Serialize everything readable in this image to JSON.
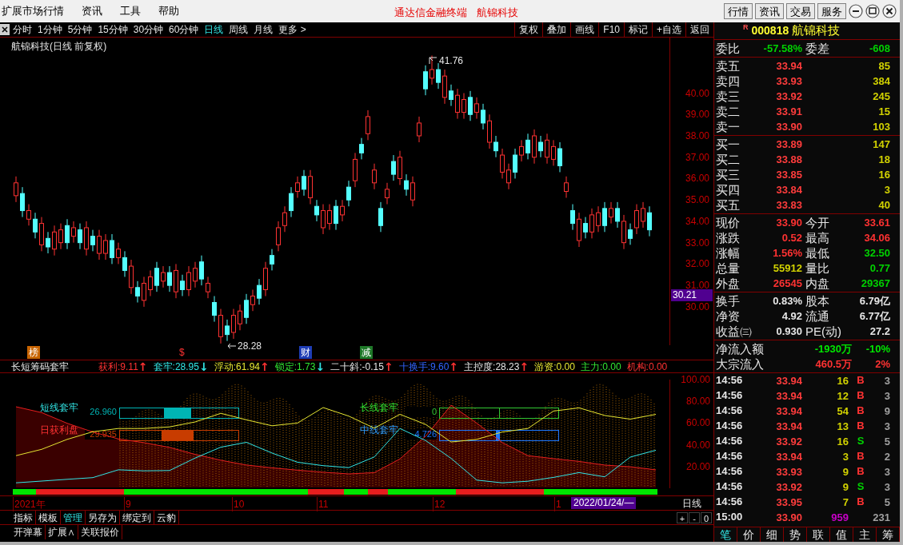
{
  "menu": [
    "扩展市场行情",
    "资讯",
    "工具",
    "帮助"
  ],
  "window": {
    "title": "通达信金融终端",
    "stock": "航锦科技"
  },
  "top_buttons": [
    "行情",
    "资讯",
    "交易",
    "服务"
  ],
  "period_tabs": [
    {
      "label": "分时",
      "selected": false
    },
    {
      "label": "1分钟",
      "selected": false
    },
    {
      "label": "5分钟",
      "selected": false
    },
    {
      "label": "15分钟",
      "selected": false
    },
    {
      "label": "30分钟",
      "selected": false
    },
    {
      "label": "60分钟",
      "selected": false
    },
    {
      "label": "日线",
      "selected": true
    },
    {
      "label": "周线",
      "selected": false
    },
    {
      "label": "月线",
      "selected": false
    },
    {
      "label": "更多 >",
      "selected": false
    }
  ],
  "tools": [
    "复权",
    "叠加",
    "画线",
    "F10",
    "标记",
    "+自选",
    "返回"
  ],
  "chart": {
    "title": "航锦科技(日线 前复权)",
    "high_label": "41.76",
    "low_label": "28.28",
    "current_price": "30.21",
    "chart_data": {
      "type": "candlestick",
      "ylim": [
        28.2,
        42.6
      ],
      "yticks": [
        {
          "value": 40,
          "label": "40.00"
        },
        {
          "value": 39,
          "label": "39.00"
        },
        {
          "value": 38,
          "label": "38.00"
        },
        {
          "value": 37,
          "label": "37.00"
        },
        {
          "value": 36,
          "label": "36.00"
        },
        {
          "value": 35,
          "label": "35.00"
        },
        {
          "value": 34,
          "label": "34.00"
        },
        {
          "value": 33,
          "label": "33.00"
        },
        {
          "value": 32,
          "label": "32.00"
        },
        {
          "value": 31,
          "label": "31.00"
        },
        {
          "value": 30,
          "label": "30.00"
        }
      ],
      "ohlc": [
        [
          35.2,
          36.1,
          34.9,
          35.8
        ],
        [
          35.3,
          35.6,
          34.2,
          34.5
        ],
        [
          34.1,
          34.8,
          33.8,
          34.5
        ],
        [
          34.1,
          34.4,
          33.2,
          33.5
        ],
        [
          32.9,
          34.2,
          32.6,
          33.9
        ],
        [
          33.2,
          33.5,
          32.5,
          32.8
        ],
        [
          32.7,
          33.8,
          32.4,
          33.5
        ],
        [
          33.0,
          33.9,
          32.7,
          33.6
        ],
        [
          33.8,
          34.1,
          32.7,
          33.0
        ],
        [
          33.3,
          34.0,
          33.0,
          33.7
        ],
        [
          33.6,
          33.9,
          32.7,
          33.0
        ],
        [
          32.7,
          34.0,
          32.4,
          33.7
        ],
        [
          33.3,
          33.6,
          32.6,
          32.9
        ],
        [
          32.5,
          33.6,
          32.2,
          33.3
        ],
        [
          32.5,
          33.4,
          32.2,
          33.1
        ],
        [
          33.1,
          33.4,
          32.0,
          32.3
        ],
        [
          32.3,
          33.0,
          32.0,
          32.7
        ],
        [
          32.3,
          32.6,
          31.4,
          31.7
        ],
        [
          30.9,
          32.2,
          30.6,
          31.9
        ],
        [
          30.9,
          31.2,
          30.2,
          30.5
        ],
        [
          30.3,
          31.4,
          30.0,
          31.1
        ],
        [
          30.8,
          31.7,
          30.5,
          31.4
        ],
        [
          31.8,
          32.1,
          30.7,
          31.0
        ],
        [
          31.2,
          31.9,
          30.9,
          31.6
        ],
        [
          31.6,
          31.9,
          30.7,
          31.0
        ],
        [
          30.7,
          32.0,
          30.4,
          31.7
        ],
        [
          31.2,
          31.5,
          30.5,
          30.8
        ],
        [
          30.8,
          31.9,
          30.5,
          31.6
        ],
        [
          31.2,
          32.1,
          30.9,
          31.8
        ],
        [
          32.1,
          32.4,
          31.0,
          31.3
        ],
        [
          30.7,
          31.4,
          30.4,
          31.1
        ],
        [
          30.2,
          30.5,
          29.3,
          29.6
        ],
        [
          28.6,
          29.9,
          28.28,
          29.6
        ],
        [
          29.1,
          29.4,
          28.4,
          28.7
        ],
        [
          28.8,
          29.9,
          28.5,
          29.6
        ],
        [
          29.2,
          30.1,
          28.9,
          29.8
        ],
        [
          30.3,
          30.6,
          29.2,
          29.5
        ],
        [
          30.1,
          30.8,
          29.8,
          30.5
        ],
        [
          31.0,
          31.3,
          30.1,
          30.4
        ],
        [
          30.8,
          32.1,
          30.5,
          31.8
        ],
        [
          32.4,
          32.7,
          31.7,
          32.0
        ],
        [
          32.9,
          34.0,
          32.6,
          33.7
        ],
        [
          33.8,
          34.7,
          33.5,
          34.4
        ],
        [
          35.3,
          35.6,
          34.2,
          34.5
        ],
        [
          35.4,
          36.1,
          35.1,
          35.8
        ],
        [
          36.1,
          36.4,
          35.2,
          35.5
        ],
        [
          35.1,
          36.4,
          34.8,
          36.1
        ],
        [
          34.7,
          35.0,
          34.0,
          34.3
        ],
        [
          33.7,
          34.8,
          33.4,
          34.5
        ],
        [
          33.9,
          34.8,
          33.6,
          34.5
        ],
        [
          34.7,
          35.0,
          33.6,
          33.9
        ],
        [
          34.3,
          35.0,
          34.0,
          34.7
        ],
        [
          35.6,
          35.9,
          34.7,
          35.0
        ],
        [
          35.9,
          37.2,
          35.6,
          36.9
        ],
        [
          37.6,
          37.9,
          36.9,
          37.2
        ],
        [
          38.1,
          39.2,
          37.8,
          38.9
        ],
        [
          35.8,
          36.7,
          35.5,
          36.4
        ],
        [
          34.6,
          34.9,
          33.5,
          33.8
        ],
        [
          35.1,
          35.8,
          34.8,
          35.5
        ],
        [
          36.8,
          37.1,
          35.9,
          36.2
        ],
        [
          36.0,
          37.3,
          35.7,
          37.0
        ],
        [
          35.9,
          36.2,
          35.2,
          35.5
        ],
        [
          35.0,
          36.1,
          34.7,
          35.8
        ],
        [
          38.0,
          38.9,
          37.7,
          38.6
        ],
        [
          41.0,
          41.3,
          39.9,
          40.2
        ],
        [
          40.7,
          41.76,
          40.4,
          41.1
        ],
        [
          41.1,
          41.4,
          40.2,
          40.5
        ],
        [
          39.8,
          41.1,
          39.5,
          40.8
        ],
        [
          40.1,
          40.4,
          39.4,
          39.7
        ],
        [
          39.1,
          40.2,
          38.8,
          39.9
        ],
        [
          39.1,
          40.0,
          38.8,
          39.7
        ],
        [
          39.8,
          40.1,
          38.7,
          39.0
        ],
        [
          39.1,
          39.8,
          38.8,
          39.5
        ],
        [
          39.2,
          39.5,
          38.3,
          38.6
        ],
        [
          37.7,
          39.0,
          37.4,
          38.7
        ],
        [
          37.7,
          38.0,
          37.0,
          37.3
        ],
        [
          36.3,
          37.4,
          36.0,
          37.1
        ],
        [
          35.8,
          36.7,
          35.5,
          36.4
        ],
        [
          37.1,
          37.4,
          36.0,
          36.3
        ],
        [
          37.1,
          37.8,
          36.8,
          37.5
        ],
        [
          37.8,
          38.1,
          36.9,
          37.2
        ],
        [
          37.0,
          38.3,
          36.7,
          38.0
        ],
        [
          37.7,
          38.0,
          37.0,
          37.3
        ],
        [
          37.0,
          38.1,
          36.7,
          37.8
        ],
        [
          36.9,
          37.8,
          36.6,
          37.5
        ],
        [
          37.4,
          37.7,
          36.3,
          36.6
        ],
        [
          35.4,
          36.1,
          35.1,
          35.8
        ],
        [
          34.5,
          34.8,
          33.6,
          33.9
        ],
        [
          33.1,
          34.4,
          32.8,
          34.1
        ],
        [
          33.9,
          34.2,
          33.2,
          33.5
        ],
        [
          33.5,
          34.6,
          33.2,
          34.3
        ],
        [
          33.8,
          34.7,
          33.5,
          34.4
        ],
        [
          34.6,
          34.9,
          33.5,
          33.8
        ],
        [
          34.2,
          34.9,
          33.9,
          34.6
        ],
        [
          34.6,
          34.9,
          33.7,
          34.0
        ],
        [
          33.0,
          34.3,
          32.7,
          34.0
        ],
        [
          33.6,
          33.9,
          32.9,
          33.2
        ],
        [
          33.7,
          34.8,
          33.4,
          34.5
        ],
        [
          34.0,
          34.9,
          33.7,
          34.6
        ],
        [
          34.4,
          34.7,
          33.3,
          33.6
        ]
      ]
    }
  },
  "markers": [
    {
      "label": "榜",
      "color": "#c86400"
    },
    {
      "label": "$",
      "color": "#000000"
    },
    {
      "label": "财",
      "color": "#1e3cb4"
    },
    {
      "label": "减",
      "color": "#1e7828"
    }
  ],
  "indicator": {
    "name": "长短筹码套牢",
    "items": [
      {
        "label": "获利:",
        "value": "9.11",
        "color": "#ff3232",
        "arrow": {
          "text": "↑",
          "color": "#ff3232"
        }
      },
      {
        "label": "套牢:",
        "value": "28.95",
        "color": "#32e6e6",
        "arrow": {
          "text": "↓",
          "color": "#32e6e6"
        }
      },
      {
        "label": "浮动:",
        "value": "61.94",
        "color": "#e6e632",
        "arrow": {
          "text": "↑",
          "color": "#ff3232"
        }
      },
      {
        "label": "锁定:",
        "value": "1.73",
        "color": "#32e632",
        "arrow": {
          "text": "↓",
          "color": "#32e6e6"
        }
      },
      {
        "label": "二十斜:",
        "value": "-0.15",
        "color": "#e6e6e6",
        "arrow": {
          "text": "↑",
          "color": "#ff3232"
        }
      },
      {
        "label": "十换手:",
        "value": "9.60",
        "color": "#3264ff",
        "arrow": {
          "text": "↑",
          "color": "#ff3232"
        }
      },
      {
        "label": "主控度:",
        "value": "28.23",
        "color": "#e6e6e6",
        "arrow": {
          "text": "↑",
          "color": "#ff3232"
        }
      },
      {
        "label": "游资:",
        "value": "0.00",
        "color": "#e6e632"
      },
      {
        "label": "主力:",
        "value": "0.00",
        "color": "#32e632"
      },
      {
        "label": "机构:",
        "value": "0.00",
        "color": "#ff3232"
      }
    ]
  },
  "indicator_panel": {
    "gauges": [
      {
        "label": "短线套牢",
        "value": "26.960",
        "color": "#00b4b4"
      },
      {
        "label": "日获利盘",
        "value": "29.935",
        "color": "#c83c00"
      },
      {
        "label": "长线套牢",
        "value": "0",
        "color": "#32c832"
      },
      {
        "label": "中线套牢",
        "value": "4.726",
        "color": "#1e78ff"
      }
    ],
    "chart_data": {
      "type": "line",
      "ylim": [
        0,
        100
      ],
      "yticks": [
        {
          "value": 20,
          "label": "20.00"
        },
        {
          "value": 40,
          "label": "40.00"
        },
        {
          "value": 60,
          "label": "60.00"
        },
        {
          "value": 80,
          "label": "80.00"
        },
        {
          "value": 100,
          "label": "100.00"
        }
      ],
      "series": [
        {
          "color": "#e61e1e",
          "values": [
            75,
            69.6,
            59.8,
            51.8,
            45.4,
            42,
            37.6,
            31.2,
            25.8,
            21.4,
            18.8,
            16.7,
            14.8,
            13.2,
            14.4,
            27,
            47.8,
            76.4,
            60,
            42,
            30,
            27.3,
            24.7,
            21.3,
            19.8,
            17
          ]
        },
        {
          "color": "#e6e632",
          "values": [
            30,
            35.8,
            45,
            52,
            55,
            55,
            56.5,
            61,
            69,
            63,
            57.5,
            60,
            74.3,
            66.4,
            55.3,
            68,
            58.8,
            42.6,
            45,
            51.8,
            55,
            71,
            74,
            67,
            63.6,
            68
          ]
        },
        {
          "color": "#32e6e6",
          "values": [
            5,
            6.6,
            8.2,
            9.8,
            17,
            16,
            16.3,
            27.8,
            37.8,
            42.3,
            32.4,
            24,
            20.8,
            19,
            28.8,
            55,
            44,
            27.5,
            7.5,
            5,
            6.5,
            10,
            14.4,
            10.5,
            28.7,
            35
          ]
        }
      ]
    }
  },
  "date_axis": [
    "2021年",
    "9",
    "10",
    "11",
    "12",
    "1"
  ],
  "cursor_date": "2022/01/24/—",
  "period_label": "日线",
  "bottom_tabs": [
    {
      "label": "指标",
      "selected": false
    },
    {
      "label": "模板",
      "selected": false
    },
    {
      "label": "管理",
      "selected": true
    },
    {
      "label": "另存为",
      "selected": false
    },
    {
      "label": "绑定到",
      "selected": false
    },
    {
      "label": "云豹",
      "selected": false
    }
  ],
  "zoom_buttons": [
    "+",
    "-",
    "0"
  ],
  "bottom_buttons": [
    "开弹幕",
    "扩展∧",
    "关联报价"
  ],
  "quote": {
    "flag": "R",
    "code": "000818",
    "name": "航锦科技",
    "ratio": {
      "label": "委比",
      "value": "-57.58%",
      "label2": "委差",
      "value2": "-608"
    },
    "sells": [
      {
        "label": "卖五",
        "price": "33.94",
        "volume": "85"
      },
      {
        "label": "卖四",
        "price": "33.93",
        "volume": "384"
      },
      {
        "label": "卖三",
        "price": "33.92",
        "volume": "245"
      },
      {
        "label": "卖二",
        "price": "33.91",
        "volume": "15"
      },
      {
        "label": "卖一",
        "price": "33.90",
        "volume": "103"
      }
    ],
    "buys": [
      {
        "label": "买一",
        "price": "33.89",
        "volume": "147"
      },
      {
        "label": "买二",
        "price": "33.88",
        "volume": "18"
      },
      {
        "label": "买三",
        "price": "33.85",
        "volume": "16"
      },
      {
        "label": "买四",
        "price": "33.84",
        "volume": "3"
      },
      {
        "label": "买五",
        "price": "33.83",
        "volume": "40"
      }
    ],
    "stats": [
      [
        {
          "label": "现价",
          "value": "33.90",
          "color": "#ff3232"
        },
        {
          "label": "今开",
          "value": "33.61",
          "color": "#ff3232"
        }
      ],
      [
        {
          "label": "涨跌",
          "value": "0.52",
          "color": "#ff3232"
        },
        {
          "label": "最高",
          "value": "34.06",
          "color": "#ff3232"
        }
      ],
      [
        {
          "label": "涨幅",
          "value": "1.56%",
          "color": "#ff3232"
        },
        {
          "label": "最低",
          "value": "32.50",
          "color": "#00d200"
        }
      ],
      [
        {
          "label": "总量",
          "value": "55912",
          "color": "#d2d200"
        },
        {
          "label": "量比",
          "value": "0.77",
          "color": "#00d200"
        }
      ],
      [
        {
          "label": "外盘",
          "value": "26545",
          "color": "#ff3232"
        },
        {
          "label": "内盘",
          "value": "29367",
          "color": "#00d200"
        }
      ]
    ],
    "fundamentals": [
      {
        "label": "换手",
        "value": "0.83%",
        "label2": "股本",
        "value2": "6.79亿"
      },
      {
        "label": "净资",
        "value": "4.92",
        "label2": "流通",
        "value2": "6.77亿"
      },
      {
        "label": "收益㈢",
        "value": "0.930",
        "label2": "PE(动)",
        "value2": "27.2"
      }
    ],
    "flows": [
      {
        "label": "净流入额",
        "value": "-1930万",
        "pct": "-10%",
        "color": "#00e600"
      },
      {
        "label": "大宗流入",
        "value": "460.5万",
        "pct": "2%",
        "color": "#ff3232"
      }
    ],
    "ticks": [
      {
        "time": "14:56",
        "price": "33.94",
        "volume": "16",
        "side": "B",
        "color": "#ff3232",
        "count": "3",
        "kind": "trade"
      },
      {
        "time": "14:56",
        "price": "33.94",
        "volume": "12",
        "side": "B",
        "color": "#ff3232",
        "count": "3",
        "kind": "trade"
      },
      {
        "time": "14:56",
        "price": "33.94",
        "volume": "54",
        "side": "B",
        "color": "#ff3232",
        "count": "9",
        "kind": "trade"
      },
      {
        "time": "14:56",
        "price": "33.94",
        "volume": "13",
        "side": "B",
        "color": "#ff3232",
        "count": "3",
        "kind": "trade"
      },
      {
        "time": "14:56",
        "price": "33.92",
        "volume": "16",
        "side": "S",
        "color": "#00d200",
        "count": "5",
        "kind": "trade"
      },
      {
        "time": "14:56",
        "price": "33.94",
        "volume": "3",
        "side": "B",
        "color": "#ff3232",
        "count": "2",
        "kind": "trade"
      },
      {
        "time": "14:56",
        "price": "33.93",
        "volume": "9",
        "side": "B",
        "color": "#ff3232",
        "count": "3",
        "kind": "trade"
      },
      {
        "time": "14:56",
        "price": "33.92",
        "volume": "9",
        "side": "S",
        "color": "#00d200",
        "count": "3",
        "kind": "trade"
      },
      {
        "time": "14:56",
        "price": "33.95",
        "volume": "7",
        "side": "B",
        "color": "#ff3232",
        "count": "5",
        "kind": "trade"
      },
      {
        "time": "15:00",
        "price": "33.90",
        "volume": "959",
        "count": "231",
        "kind": "summary"
      }
    ],
    "panel_tabs": [
      {
        "label": "笔",
        "selected": true
      },
      {
        "label": "价",
        "selected": false
      },
      {
        "label": "细",
        "selected": false
      },
      {
        "label": "势",
        "selected": false
      },
      {
        "label": "联",
        "selected": false
      },
      {
        "label": "值",
        "selected": false
      },
      {
        "label": "主",
        "selected": false
      },
      {
        "label": "筹",
        "selected": false
      }
    ]
  }
}
